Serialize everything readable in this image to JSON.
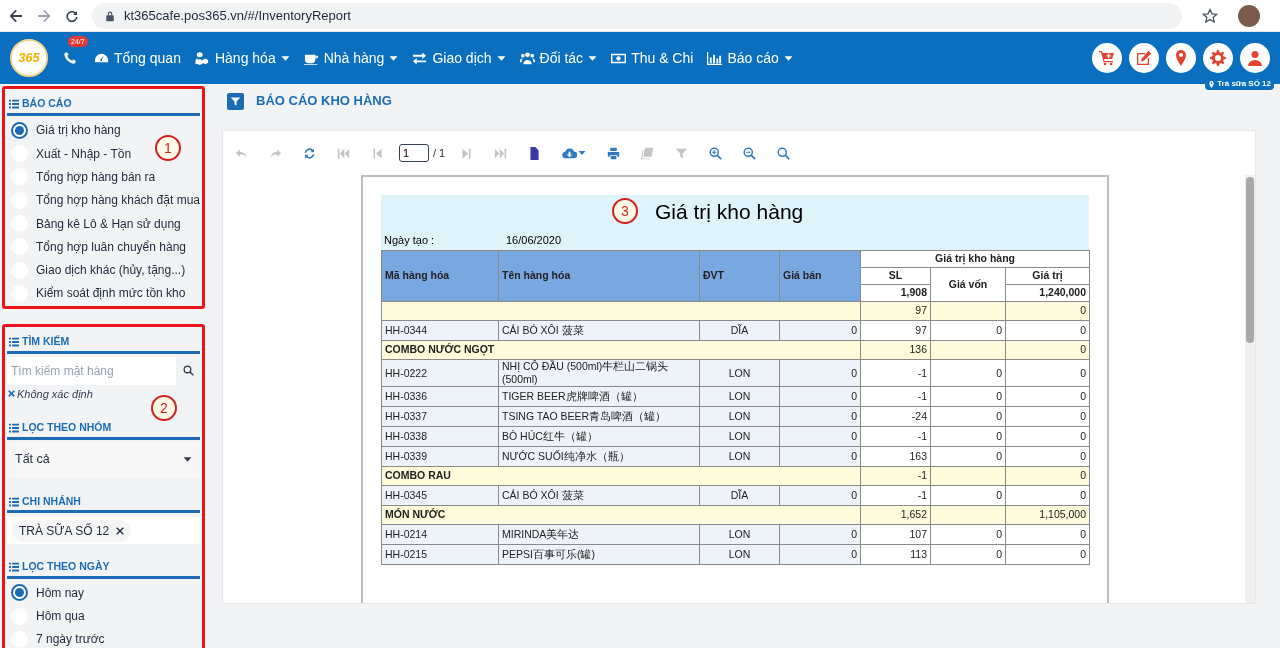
{
  "browser": {
    "url": "kt365cafe.pos365.vn/#/InventoryReport"
  },
  "nav": {
    "logo": "365",
    "badge": "24/7",
    "items": [
      {
        "label": "Tổng quan",
        "kind": "gauge",
        "dropdown": false
      },
      {
        "label": "Hàng hóa",
        "kind": "cubes",
        "dropdown": true
      },
      {
        "label": "Nhà hàng",
        "kind": "cup",
        "dropdown": true
      },
      {
        "label": "Giao dịch",
        "kind": "exchange",
        "dropdown": true
      },
      {
        "label": "Đối tác",
        "kind": "users",
        "dropdown": true
      },
      {
        "label": "Thu & Chi",
        "kind": "money",
        "dropdown": false
      },
      {
        "label": "Báo cáo",
        "kind": "chart",
        "dropdown": true
      }
    ],
    "actions": [
      {
        "kind": "cart"
      },
      {
        "kind": "edit"
      },
      {
        "kind": "pin"
      },
      {
        "kind": "gear"
      },
      {
        "kind": "user"
      }
    ],
    "branch": "Trà sữa SỐ 12"
  },
  "sidebar": {
    "reports": {
      "title": "BÁO CÁO",
      "items": [
        {
          "label": "Giá trị kho hàng",
          "selected": true
        },
        {
          "label": "Xuất - Nhập - Tồn",
          "selected": false
        },
        {
          "label": "Tổng hợp hàng bán ra",
          "selected": false
        },
        {
          "label": "Tổng hợp hàng khách đặt mua",
          "selected": false
        },
        {
          "label": "Bảng kê Lô & Hạn sử dụng",
          "selected": false
        },
        {
          "label": "Tổng hợp luân chuyển hàng",
          "selected": false
        },
        {
          "label": "Giao dịch khác (hủy, tặng...)",
          "selected": false
        },
        {
          "label": "Kiểm soát định mức tồn kho",
          "selected": false
        }
      ]
    },
    "search": {
      "title": "TÌM KIẾM",
      "placeholder": "Tìm kiếm mặt hàng",
      "chip": "Không xác định"
    },
    "group": {
      "title": "LỌC THEO NHÓM",
      "value": "Tất cả"
    },
    "branch": {
      "title": "CHI NHÁNH",
      "tag": "TRÀ SỮA SỐ 12"
    },
    "date": {
      "title": "LỌC THEO NGÀY",
      "items": [
        {
          "label": "Hôm nay",
          "selected": true
        },
        {
          "label": "Hôm qua",
          "selected": false
        },
        {
          "label": "7 ngày trước",
          "selected": false
        }
      ]
    }
  },
  "annotations": [
    {
      "label": "1"
    },
    {
      "label": "2"
    },
    {
      "label": "3"
    }
  ],
  "page_title": "BÁO CÁO KHO HÀNG",
  "toolbar": [
    {
      "kind": "undo",
      "disabled": true
    },
    {
      "kind": "redo",
      "disabled": true
    },
    {
      "kind": "refresh",
      "disabled": false
    },
    {
      "kind": "first",
      "disabled": true
    },
    {
      "kind": "prev",
      "disabled": true
    },
    {
      "kind": "page",
      "value": "1",
      "total": "/ 1"
    },
    {
      "kind": "next",
      "disabled": true
    },
    {
      "kind": "last",
      "disabled": true
    },
    {
      "kind": "document",
      "disabled": false
    },
    {
      "kind": "download",
      "disabled": false
    },
    {
      "kind": "print",
      "disabled": false
    },
    {
      "kind": "copy",
      "disabled": true
    },
    {
      "kind": "filter",
      "disabled": true
    },
    {
      "kind": "zoom-in",
      "disabled": false
    },
    {
      "kind": "zoom-out",
      "disabled": false
    },
    {
      "kind": "search",
      "disabled": false
    }
  ],
  "report": {
    "title": "Giá trị kho hàng",
    "created_label": "Ngày tạo :",
    "created": "16/06/2020",
    "columns": [
      "Mã hàng hóa",
      "Tên hàng hóa",
      "ĐVT",
      "Giá bán"
    ],
    "group_heading": "Giá trị kho hàng",
    "sub_columns": [
      "SL",
      "Giá vốn",
      "Giá trị"
    ],
    "totals": {
      "sl": "1,908",
      "value": "1,240,000"
    },
    "rows": [
      {
        "kind": "group",
        "name": "",
        "sl": "97",
        "value": "0"
      },
      {
        "kind": "item",
        "cells": [
          "HH-0344",
          "CẢI BÓ XÔI 菠菜",
          "DĨA",
          "0",
          "97",
          "0",
          "0"
        ]
      },
      {
        "kind": "group",
        "name": "COMBO NƯỚC NGỌT",
        "sl": "136",
        "value": "0"
      },
      {
        "kind": "item",
        "cells": [
          "HH-0222",
          "NHỊ CÔ ĐẦU (500ml)牛栏山二锅头 (500ml)",
          "LON",
          "0",
          "-1",
          "0",
          "0"
        ]
      },
      {
        "kind": "item",
        "cells": [
          "HH-0336",
          "TIGER BEER虎牌啤酒（罐）",
          "LON",
          "0",
          "-1",
          "0",
          "0"
        ]
      },
      {
        "kind": "item",
        "cells": [
          "HH-0337",
          "TSING TAO BEER青岛啤酒（罐）",
          "LON",
          "0",
          "-24",
          "0",
          "0"
        ]
      },
      {
        "kind": "item",
        "cells": [
          "HH-0338",
          "BÒ HÚC红牛（罐）",
          "LON",
          "0",
          "-1",
          "0",
          "0"
        ]
      },
      {
        "kind": "item",
        "cells": [
          "HH-0339",
          "NƯỚC SUỐI纯净水（瓶）",
          "LON",
          "0",
          "163",
          "0",
          "0"
        ]
      },
      {
        "kind": "group",
        "name": "COMBO RAU",
        "sl": "-1",
        "value": "0"
      },
      {
        "kind": "item",
        "cells": [
          "HH-0345",
          "CẢI BÓ XÔI 菠菜",
          "DĨA",
          "0",
          "-1",
          "0",
          "0"
        ]
      },
      {
        "kind": "group",
        "name": "MÓN NƯỚC",
        "sl": "1,652",
        "value": "1,105,000"
      },
      {
        "kind": "item",
        "cells": [
          "HH-0214",
          "MIRINDA美年达",
          "LON",
          "0",
          "107",
          "0",
          "0"
        ]
      },
      {
        "kind": "item",
        "cells": [
          "HH-0215",
          "PEPSI百事可乐(罐)",
          "LON",
          "0",
          "113",
          "0",
          "0"
        ]
      }
    ]
  }
}
